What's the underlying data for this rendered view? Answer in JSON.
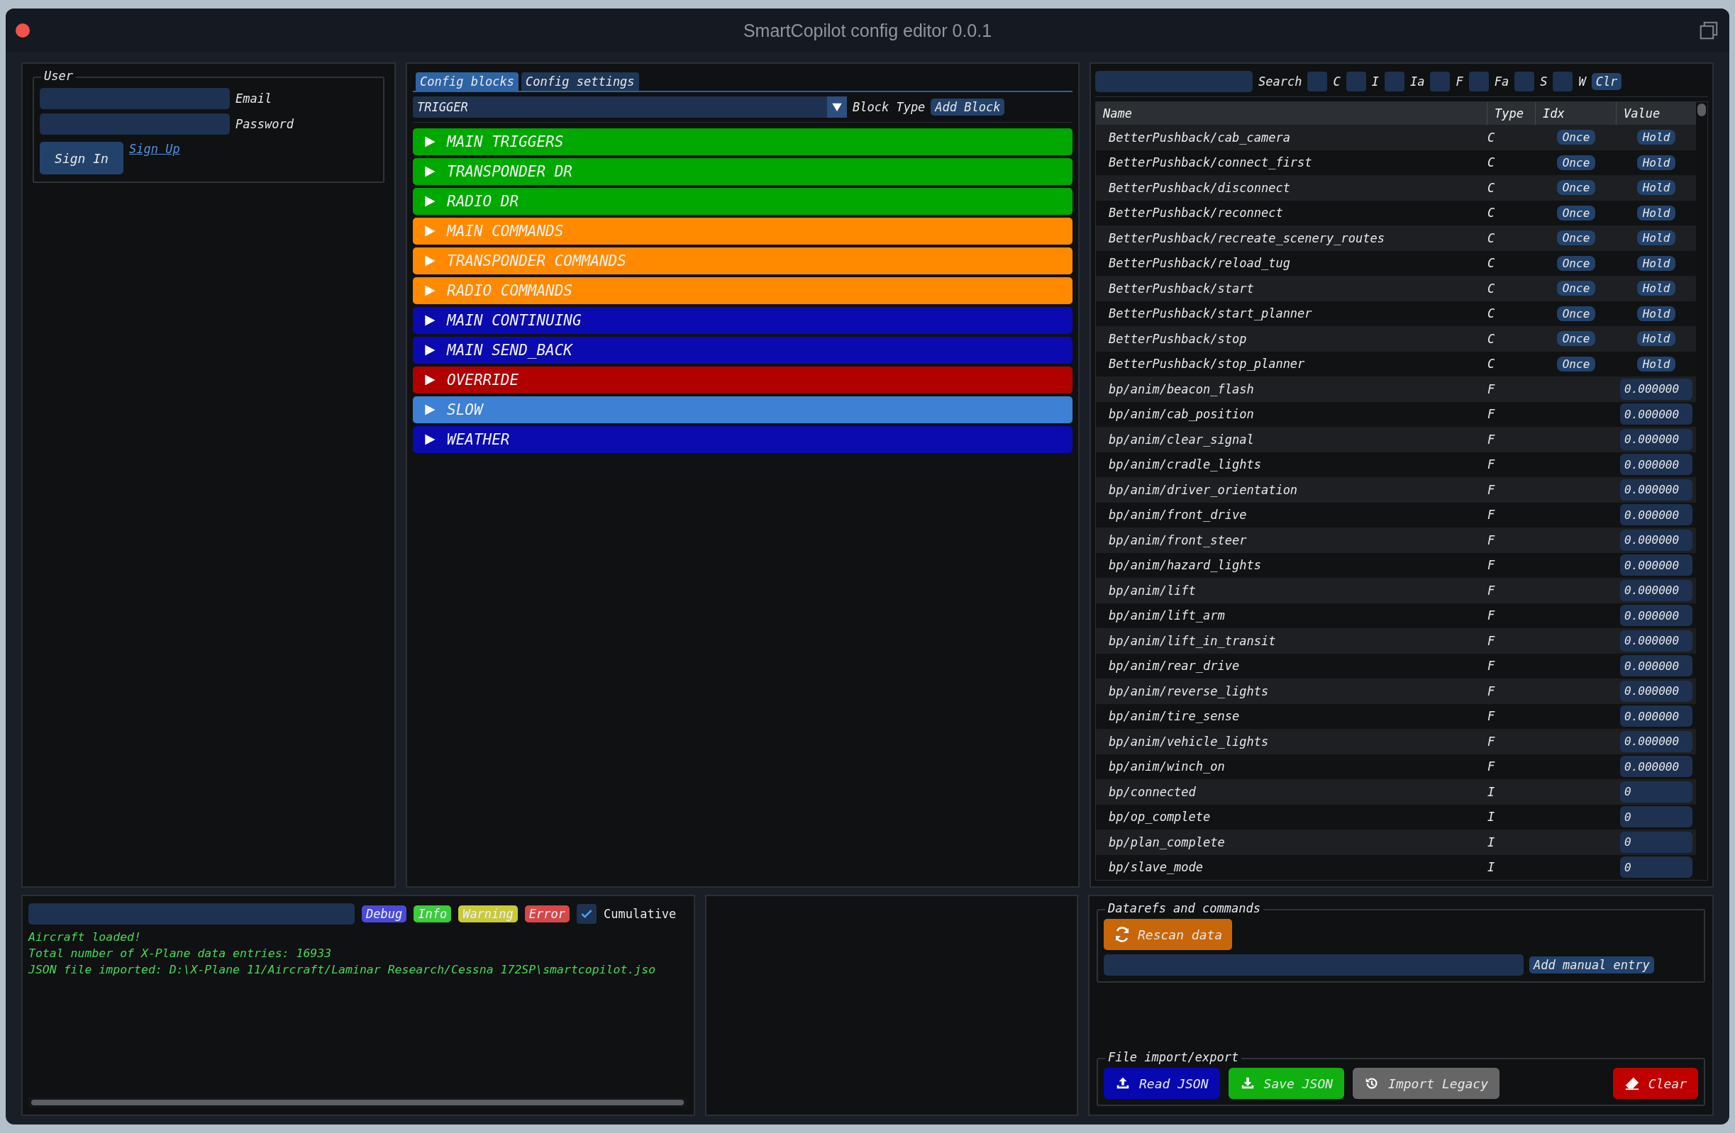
{
  "window": {
    "title": "SmartCopilot config editor 0.0.1"
  },
  "user": {
    "legend": "User",
    "fields": [
      {
        "label": "Email"
      },
      {
        "label": "Password"
      }
    ],
    "sign_in": "Sign In",
    "sign_up": "Sign Up"
  },
  "config": {
    "tabs": [
      {
        "label": "Config blocks",
        "selected": true
      },
      {
        "label": "Config settings",
        "selected": false
      }
    ],
    "block_type": {
      "value": "TRIGGER",
      "label": "Block Type"
    },
    "add_block": "Add Block",
    "blocks": [
      {
        "label": "MAIN TRIGGERS",
        "color": "#00a800",
        "expanded": false
      },
      {
        "label": "TRANSPONDER DR",
        "color": "#00a800",
        "expanded": false
      },
      {
        "label": "RADIO DR",
        "color": "#00a800",
        "expanded": false
      },
      {
        "label": "MAIN COMMANDS",
        "color": "#ff8a00",
        "expanded": false
      },
      {
        "label": "TRANSPONDER COMMANDS",
        "color": "#ff8a00",
        "expanded": false
      },
      {
        "label": "RADIO COMMANDS",
        "color": "#ff8a00",
        "expanded": false
      },
      {
        "label": "MAIN CONTINUING",
        "color": "#0a0ab0",
        "expanded": false
      },
      {
        "label": "MAIN SEND_BACK",
        "color": "#0a0ab0",
        "expanded": false
      },
      {
        "label": "OVERRIDE",
        "color": "#b00000",
        "expanded": false
      },
      {
        "label": "SLOW",
        "color": "#3d80d4",
        "expanded": false
      },
      {
        "label": "WEATHER",
        "color": "#0a0ab0",
        "expanded": false
      }
    ]
  },
  "datarefs": {
    "search_label": "Search",
    "filters": [
      {
        "label": "C",
        "checked": false
      },
      {
        "label": "I",
        "checked": false
      },
      {
        "label": "Ia",
        "checked": false
      },
      {
        "label": "F",
        "checked": false
      },
      {
        "label": "Fa",
        "checked": false
      },
      {
        "label": "S",
        "checked": false
      },
      {
        "label": "W",
        "checked": false
      }
    ],
    "clear": "Clr",
    "table": {
      "columns": [
        "Name",
        "Type",
        "Idx",
        "Value"
      ],
      "rows": [
        {
          "kind": "command",
          "name": "BetterPushback/cab_camera",
          "type": "C",
          "idx": "Once",
          "value": "Hold"
        },
        {
          "kind": "command",
          "name": "BetterPushback/connect_first",
          "type": "C",
          "idx": "Once",
          "value": "Hold"
        },
        {
          "kind": "command",
          "name": "BetterPushback/disconnect",
          "type": "C",
          "idx": "Once",
          "value": "Hold"
        },
        {
          "kind": "command",
          "name": "BetterPushback/reconnect",
          "type": "C",
          "idx": "Once",
          "value": "Hold"
        },
        {
          "kind": "command",
          "name": "BetterPushback/recreate_scenery_routes",
          "type": "C",
          "idx": "Once",
          "value": "Hold"
        },
        {
          "kind": "command",
          "name": "BetterPushback/reload_tug",
          "type": "C",
          "idx": "Once",
          "value": "Hold"
        },
        {
          "kind": "command",
          "name": "BetterPushback/start",
          "type": "C",
          "idx": "Once",
          "value": "Hold"
        },
        {
          "kind": "command",
          "name": "BetterPushback/start_planner",
          "type": "C",
          "idx": "Once",
          "value": "Hold"
        },
        {
          "kind": "command",
          "name": "BetterPushback/stop",
          "type": "C",
          "idx": "Once",
          "value": "Hold"
        },
        {
          "kind": "command",
          "name": "BetterPushback/stop_planner",
          "type": "C",
          "idx": "Once",
          "value": "Hold"
        },
        {
          "kind": "value",
          "name": "bp/anim/beacon_flash",
          "type": "F",
          "value": "0.000000"
        },
        {
          "kind": "value",
          "name": "bp/anim/cab_position",
          "type": "F",
          "value": "0.000000"
        },
        {
          "kind": "value",
          "name": "bp/anim/clear_signal",
          "type": "F",
          "value": "0.000000"
        },
        {
          "kind": "value",
          "name": "bp/anim/cradle_lights",
          "type": "F",
          "value": "0.000000"
        },
        {
          "kind": "value",
          "name": "bp/anim/driver_orientation",
          "type": "F",
          "value": "0.000000"
        },
        {
          "kind": "value",
          "name": "bp/anim/front_drive",
          "type": "F",
          "value": "0.000000"
        },
        {
          "kind": "value",
          "name": "bp/anim/front_steer",
          "type": "F",
          "value": "0.000000"
        },
        {
          "kind": "value",
          "name": "bp/anim/hazard_lights",
          "type": "F",
          "value": "0.000000"
        },
        {
          "kind": "value",
          "name": "bp/anim/lift",
          "type": "F",
          "value": "0.000000"
        },
        {
          "kind": "value",
          "name": "bp/anim/lift_arm",
          "type": "F",
          "value": "0.000000"
        },
        {
          "kind": "value",
          "name": "bp/anim/lift_in_transit",
          "type": "F",
          "value": "0.000000"
        },
        {
          "kind": "value",
          "name": "bp/anim/rear_drive",
          "type": "F",
          "value": "0.000000"
        },
        {
          "kind": "value",
          "name": "bp/anim/reverse_lights",
          "type": "F",
          "value": "0.000000"
        },
        {
          "kind": "value",
          "name": "bp/anim/tire_sense",
          "type": "F",
          "value": "0.000000"
        },
        {
          "kind": "value",
          "name": "bp/anim/vehicle_lights",
          "type": "F",
          "value": "0.000000"
        },
        {
          "kind": "value",
          "name": "bp/anim/winch_on",
          "type": "F",
          "value": "0.000000"
        },
        {
          "kind": "value",
          "name": "bp/connected",
          "type": "I",
          "value": "0"
        },
        {
          "kind": "value",
          "name": "bp/op_complete",
          "type": "I",
          "value": "0"
        },
        {
          "kind": "value",
          "name": "bp/plan_complete",
          "type": "I",
          "value": "0"
        },
        {
          "kind": "value",
          "name": "bp/slave_mode",
          "type": "I",
          "value": "0"
        }
      ]
    }
  },
  "log": {
    "levels": [
      {
        "label": "Debug",
        "color": "#4a4ad8"
      },
      {
        "label": "Info",
        "color": "#3ccc3c"
      },
      {
        "label": "Warning",
        "color": "#c9c93a"
      },
      {
        "label": "Error",
        "color": "#d64848"
      }
    ],
    "cumulative": {
      "label": "Cumulative",
      "checked": true
    },
    "lines": [
      "Aircraft loaded!",
      "Total number of X-Plane data entries: 16933",
      "JSON file imported: D:\\X-Plane 11/Aircraft/Laminar Research/Cessna 172SP\\smartcopilot.jso"
    ]
  },
  "datarefs_box": {
    "legend": "Datarefs and commands",
    "rescan": "Rescan data",
    "add_manual": "Add manual entry"
  },
  "files": {
    "legend": "File import/export",
    "buttons": [
      {
        "kind": "read",
        "label": "Read JSON"
      },
      {
        "kind": "save",
        "label": "Save JSON"
      },
      {
        "kind": "legacy",
        "label": "Import Legacy"
      },
      {
        "kind": "clear",
        "label": "Clear"
      }
    ]
  }
}
